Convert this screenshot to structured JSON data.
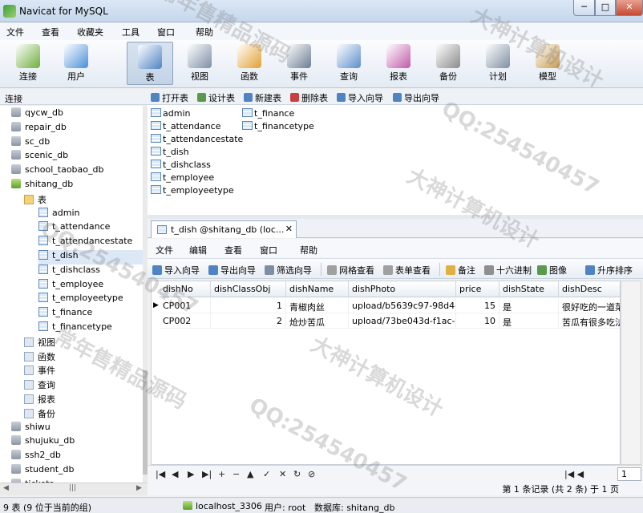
{
  "window": {
    "title": "Navicat for MySQL",
    "min": "─",
    "max": "□",
    "close": "✕"
  },
  "menu": [
    "文件",
    "查看",
    "收藏夹",
    "工具",
    "窗口",
    "帮助"
  ],
  "toolbar": [
    {
      "label": "连接",
      "icon": "connection-icon",
      "color": "#6fae3c"
    },
    {
      "label": "用户",
      "icon": "user-icon",
      "color": "#4a8fd8"
    },
    {
      "label": "表",
      "icon": "table-icon",
      "color": "#4f83c2"
    },
    {
      "label": "视图",
      "icon": "view-icon",
      "color": "#7c8fa6"
    },
    {
      "label": "函数",
      "icon": "function-icon",
      "color": "#e0a030"
    },
    {
      "label": "事件",
      "icon": "event-icon",
      "color": "#6b7d93"
    },
    {
      "label": "查询",
      "icon": "query-icon",
      "color": "#5d8ecb"
    },
    {
      "label": "报表",
      "icon": "report-icon",
      "color": "#c05aa8"
    },
    {
      "label": "备份",
      "icon": "backup-icon",
      "color": "#8a8a8a"
    },
    {
      "label": "计划",
      "icon": "schedule-icon",
      "color": "#7f8fa3"
    },
    {
      "label": "模型",
      "icon": "model-icon",
      "color": "#c99b4f"
    }
  ],
  "left_header": "连接",
  "tree": {
    "databases_top": [
      "qycw_db",
      "repair_db",
      "sc_db",
      "scenic_db",
      "school_taobao_db"
    ],
    "open_db": "shitang_db",
    "tables_folder": "表",
    "tables": [
      "admin",
      "t_attendance",
      "t_attendancestate",
      "t_dish",
      "t_dishclass",
      "t_employee",
      "t_employeetype",
      "t_finance",
      "t_financetype"
    ],
    "objects": [
      "视图",
      "函数",
      "事件",
      "查询",
      "报表",
      "备份"
    ],
    "databases_bottom": [
      "shiwu",
      "shujuku_db",
      "ssh2_db",
      "student_db",
      "tickets"
    ]
  },
  "object_toolbar": [
    {
      "label": "打开表",
      "color": "#4f83c2"
    },
    {
      "label": "设计表",
      "color": "#5a9a4a"
    },
    {
      "label": "新建表",
      "color": "#4f83c2"
    },
    {
      "label": "删除表",
      "color": "#c84040"
    },
    {
      "label": "导入向导",
      "color": "#4f83c2"
    },
    {
      "label": "导出向导",
      "color": "#4f83c2"
    }
  ],
  "object_list": {
    "col1": [
      "admin",
      "t_attendance",
      "t_attendancestate",
      "t_dish",
      "t_dishclass",
      "t_employee",
      "t_employeetype"
    ],
    "col2": [
      "t_finance",
      "t_financetype"
    ]
  },
  "tab": {
    "label": "t_dish @shitang_db (loc...",
    "close": "✕"
  },
  "data_menu": [
    "文件",
    "编辑",
    "查看",
    "窗口",
    "帮助"
  ],
  "data_toolbar": [
    "导入向导",
    "导出向导",
    "筛选向导",
    "网格查看",
    "表单查看",
    "备注",
    "十六进制",
    "图像",
    "升序排序"
  ],
  "grid": {
    "columns": [
      "dishNo",
      "dishClassObj",
      "dishName",
      "dishPhoto",
      "price",
      "dishState",
      "dishDesc"
    ],
    "rows": [
      [
        "CP001",
        "1",
        "青椒肉丝",
        "upload/b5639c97-98d4-4",
        "15",
        "是",
        "很好吃的一道菜"
      ],
      [
        "CP002",
        "2",
        "炝炒苦瓜",
        "upload/73be043d-f1ac-4",
        "10",
        "是",
        "苦瓜有很多吃法"
      ]
    ],
    "row_marker": "▶"
  },
  "nav": [
    "|◀",
    "◀",
    "▶",
    "▶|",
    "+",
    "−",
    "▲",
    "✓",
    "✕",
    "↻",
    "⊘"
  ],
  "nav_right": "|◀ ◀",
  "page_number": "1",
  "page_info": "第 1 条记录 (共 2 条) 于 1 页",
  "status": {
    "left": "9 表 (9 位于当前的组)",
    "conn": "localhost_3306",
    "user": "用户: root",
    "db": "数据库: shitang_db"
  },
  "watermarks": [
    "大神计算机设计",
    "QQ:254540457",
    "常年售精品源码"
  ]
}
